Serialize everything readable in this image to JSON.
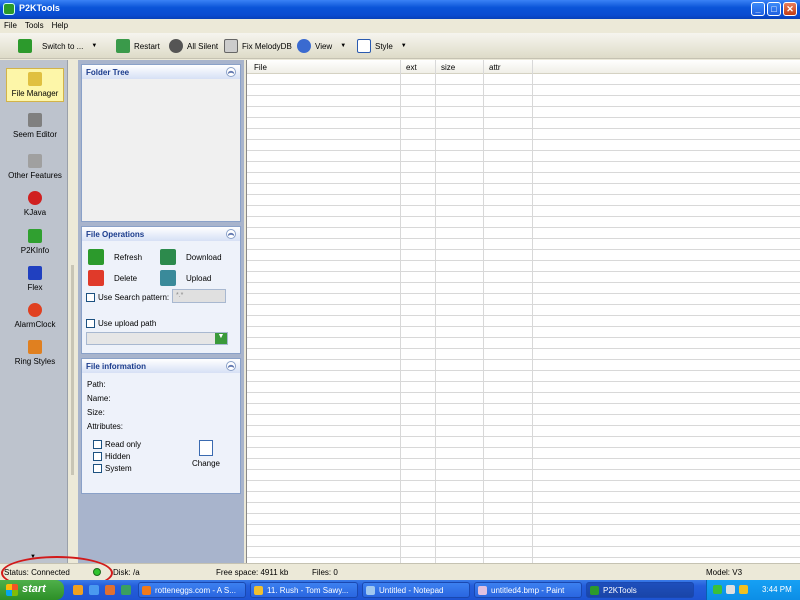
{
  "window": {
    "title": "P2KTools",
    "controls": [
      "_",
      "□",
      "✕"
    ]
  },
  "menu": [
    "File",
    "Tools",
    "Help"
  ],
  "toolbar": {
    "switch_label": "Switch to ...",
    "restart_label": "Restart",
    "all_silent_label": "All Silent",
    "fix_melody_label": "Fix MelodyDB",
    "view_label": "View",
    "style_label": "Style"
  },
  "nav": [
    {
      "label": "File Manager",
      "icon": "file-manager-icon",
      "color": "#e0c040"
    },
    {
      "label": "Seem Editor",
      "icon": "seem-editor-icon",
      "color": "#808080"
    },
    {
      "label": "Other Features",
      "icon": "other-features-icon",
      "color": "#a0a0a0"
    },
    {
      "label": "KJava",
      "icon": "kjava-icon",
      "color": "#d02020"
    },
    {
      "label": "P2KInfo",
      "icon": "p2kinfo-icon",
      "color": "#30a030"
    },
    {
      "label": "Flex",
      "icon": "flex-icon",
      "color": "#2040c0"
    },
    {
      "label": "AlarmClock",
      "icon": "alarm-clock-icon",
      "color": "#e04020"
    },
    {
      "label": "Ring Styles",
      "icon": "ring-styles-icon",
      "color": "#e08020"
    }
  ],
  "folder_tree": {
    "title": "Folder Tree"
  },
  "file_operations": {
    "title": "File Operations",
    "refresh": "Refresh",
    "download": "Download",
    "delete": "Delete",
    "upload": "Upload",
    "use_search_pattern": "Use Search pattern:",
    "search_pattern_value": "*.*",
    "use_upload_path": "Use upload path"
  },
  "file_information": {
    "title": "File information",
    "path": "Path:",
    "name": "Name:",
    "size": "Size:",
    "attributes": "Attributes:",
    "read_only": "Read only",
    "hidden": "Hidden",
    "system": "System",
    "change": "Change"
  },
  "grid": {
    "columns": [
      "File",
      "ext",
      "size",
      "attr"
    ]
  },
  "status": {
    "status_text": "Status: Connected",
    "disk": "Disk: /a",
    "free_space": "Free space: 4911 kb",
    "files": "Files: 0",
    "model": "Model: V3"
  },
  "taskbar": {
    "start": "start",
    "tasks": [
      "rotteneggs.com - A S...",
      "11. Rush - Tom Sawy...",
      "Untitled - Notepad",
      "untitled4.bmp - Paint",
      "P2KTools"
    ],
    "clock": "3:44 PM"
  }
}
